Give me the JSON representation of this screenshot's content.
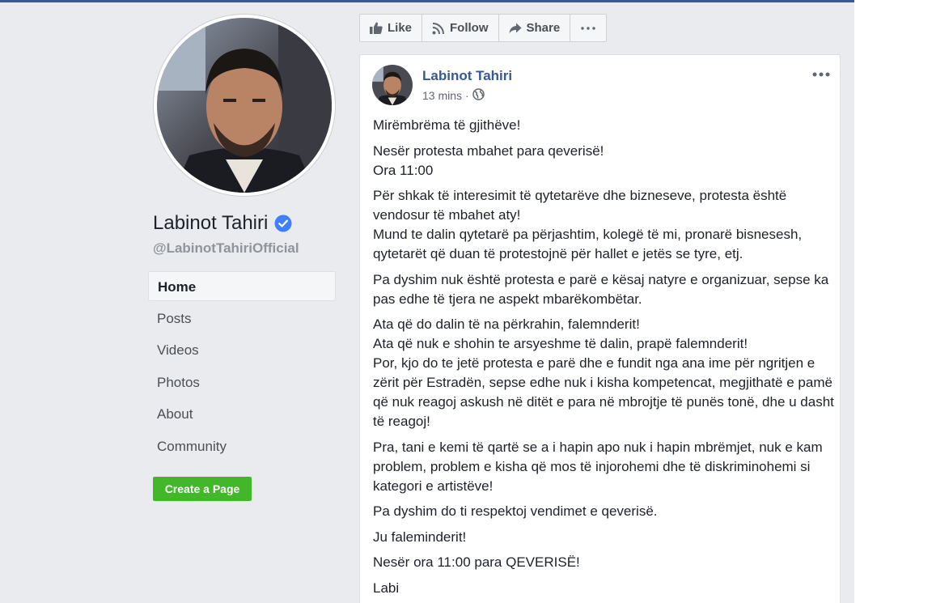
{
  "page": {
    "name": "Labinot Tahiri",
    "handle": "@LabinotTahiriOfficial",
    "verified": true
  },
  "nav": {
    "items": [
      {
        "label": "Home",
        "active": true
      },
      {
        "label": "Posts"
      },
      {
        "label": "Videos"
      },
      {
        "label": "Photos"
      },
      {
        "label": "About"
      },
      {
        "label": "Community"
      }
    ],
    "create_page_label": "Create a Page"
  },
  "actions": {
    "like": "Like",
    "follow": "Follow",
    "share": "Share",
    "more_icon": "ellipsis-icon"
  },
  "post": {
    "author": "Labinot Tahiri",
    "time": "13 mins",
    "separator": "·",
    "audience_icon": "globe-icon",
    "paragraphs": [
      "Mirëmbrëma të gjithëve!",
      "Nesër protesta mbahet para qeverisë!\nOra 11:00",
      "Për shkak të interesimit të qytetarëve dhe bizneseve, protesta është vendosur të mbahet aty!\nMund te dalin qytetarë pa përjashtim, kolegë të mi, pronarë bisnesesh, qytetarët që duan të protestojnë për hallet e jetës se tyre, etj.",
      "Pa dyshim nuk është protesta e parë e kësaj natyre e organizuar, sepse ka pas edhe të tjera ne aspekt mbarëkombëtar.",
      "Ata që do dalin të na përkrahin, falemnderit!\nAta që nuk e shohin te arsyeshme të dalin, prapë falemnderit!\nPor, kjo do te jetë protesta e parë dhe e fundit nga ana ime për ngritjen e zërit për Estradën, sepse edhe nuk i kisha kompetencat, megjithatë e pamë që nuk reagoj askush në ditët e para në mbrojtje të punës tonë, dhe u dasht të reagoj!",
      "Pra, tani e kemi të qartë se a i hapin apo nuk i hapin mbrëmjet, nuk e kam problem, problem e kisha që mos të injorohemi dhe të diskriminohemi si kategori e artistëve!",
      "Pa dyshim do ti respektoj vendimet e qeverisë.",
      "Ju faleminderit!",
      "Nesër ora 11:00 para QEVERISË!",
      "Labi"
    ]
  },
  "colors": {
    "brand": "#3b5998",
    "link": "#365899",
    "create_button": "#42b72a",
    "verified": "#4080ff",
    "background": "#e9ebee"
  }
}
